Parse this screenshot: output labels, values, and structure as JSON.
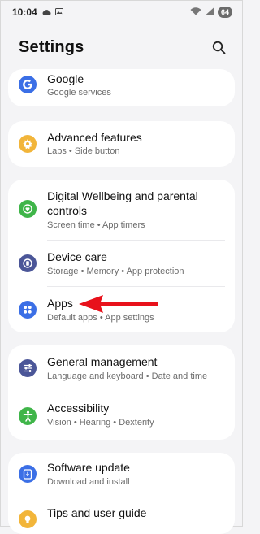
{
  "status_bar": {
    "time": "10:04",
    "battery": "64"
  },
  "header": {
    "title": "Settings"
  },
  "items": {
    "google": {
      "title": "Google",
      "subtitle": "Google services",
      "icon": "google-icon",
      "color": "#3b6fe6"
    },
    "advanced": {
      "title": "Advanced features",
      "subtitle": "Labs  •  Side button",
      "icon": "gear-star-icon",
      "color": "#f2b53a"
    },
    "wellbeing": {
      "title": "Digital Wellbeing and parental controls",
      "subtitle": "Screen time  •  App timers",
      "icon": "heart-icon",
      "color": "#3fb549"
    },
    "device_care": {
      "title": "Device care",
      "subtitle": "Storage  •  Memory  •  App protection",
      "icon": "device-care-icon",
      "color": "#4b5698"
    },
    "apps": {
      "title": "Apps",
      "subtitle": "Default apps  •  App settings",
      "icon": "apps-grid-icon",
      "color": "#3b6fe6"
    },
    "general": {
      "title": "General management",
      "subtitle": "Language and keyboard  •  Date and time",
      "icon": "sliders-icon",
      "color": "#4b5698"
    },
    "accessibility": {
      "title": "Accessibility",
      "subtitle": "Vision  •  Hearing  •  Dexterity",
      "icon": "accessibility-icon",
      "color": "#3fb549"
    },
    "software_update": {
      "title": "Software update",
      "subtitle": "Download and install",
      "icon": "update-icon",
      "color": "#3b6fe6"
    },
    "tips": {
      "title": "Tips and user guide",
      "icon": "bulb-icon",
      "color": "#f2b53a"
    }
  },
  "annotation": {
    "arrow_color": "#e8111b"
  }
}
